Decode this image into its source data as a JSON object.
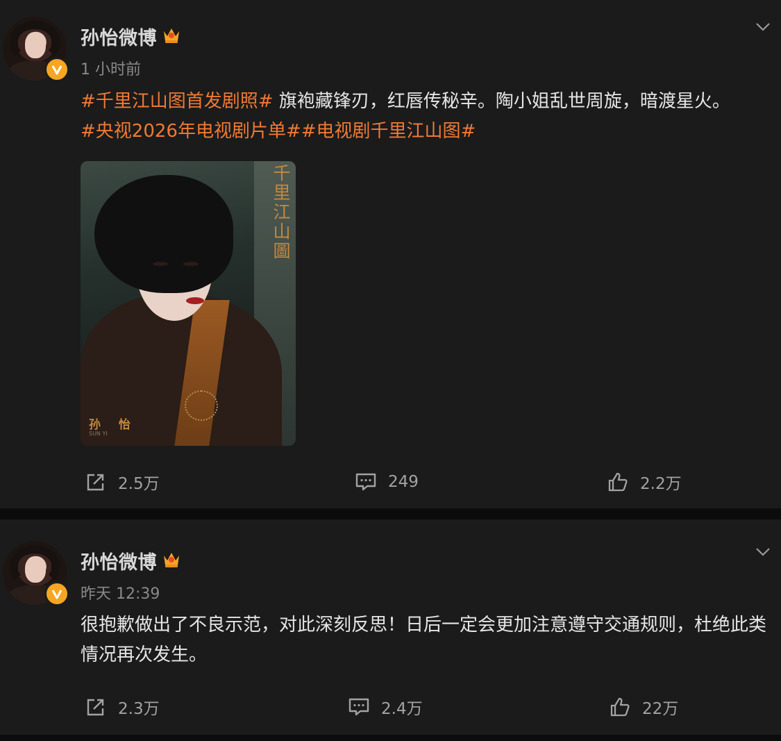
{
  "posts": [
    {
      "username": "孙怡微博",
      "timestamp": "1 小时前",
      "text_parts": [
        {
          "text": "#千里江山图首发剧照#",
          "tag": true
        },
        {
          "text": " 旗袍藏锋刃，红唇传秘辛。陶小姐乱世周旋，暗渡星火。",
          "tag": false
        },
        {
          "text": "#央视2026年电视剧片单#",
          "tag": true
        },
        {
          "text": "#电视剧千里江山图#",
          "tag": true
        }
      ],
      "image": {
        "title_vertical": "千里江山圖",
        "actor_name": "孙 怡",
        "actor_name_en": "SUN YI"
      },
      "repost_count": "2.5万",
      "comment_count": "249",
      "like_count": "2.2万"
    },
    {
      "username": "孙怡微博",
      "timestamp": "昨天 12:39",
      "text": "很抱歉做出了不良示范，对此深刻反思！日后一定会更加注意遵守交通规则，杜绝此类情况再次发生。",
      "repost_count": "2.3万",
      "comment_count": "2.4万",
      "like_count": "22万"
    }
  ],
  "colors": {
    "tag": "#f07a34",
    "badge": "#f5a623",
    "background": "#1b1b1b"
  },
  "icons": [
    "crown-icon",
    "verified-v-icon",
    "chevron-down-icon",
    "repost-icon",
    "comment-icon",
    "like-icon"
  ]
}
